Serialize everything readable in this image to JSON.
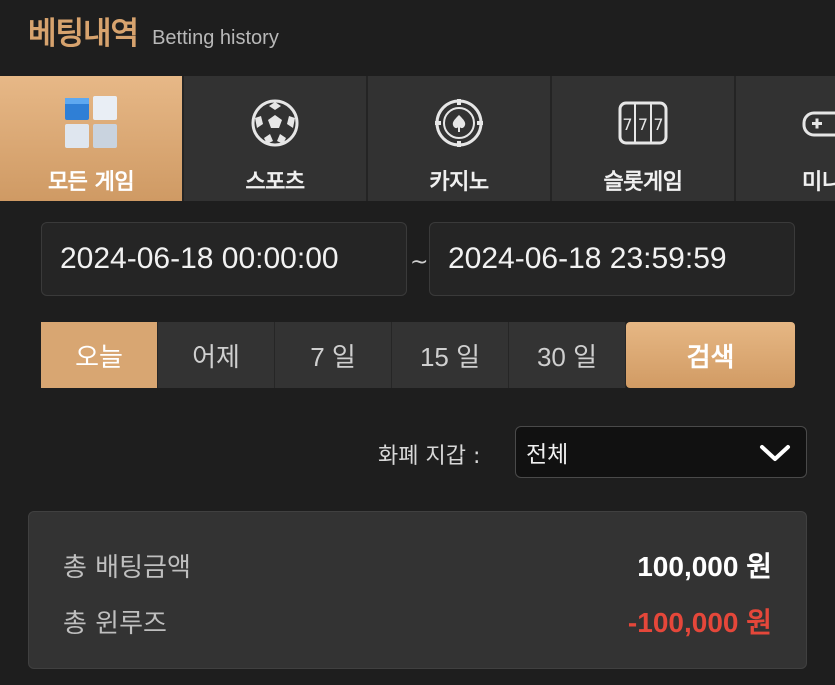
{
  "header": {
    "title": "베팅내역",
    "subtitle": "Betting history"
  },
  "tabs": [
    {
      "label": "모든 게임",
      "icon": "all-games-icon",
      "active": true
    },
    {
      "label": "스포츠",
      "icon": "soccer-ball-icon",
      "active": false
    },
    {
      "label": "카지노",
      "icon": "casino-chip-icon",
      "active": false
    },
    {
      "label": "슬롯게임",
      "icon": "slot-machine-icon",
      "active": false
    },
    {
      "label": "미니",
      "icon": "gamepad-icon",
      "active": false
    }
  ],
  "date_range": {
    "start": "2024-06-18 00:00:00",
    "separator": "~",
    "end": "2024-06-18 23:59:59"
  },
  "periods": [
    {
      "label": "오늘",
      "active": true
    },
    {
      "label": "어제",
      "active": false
    },
    {
      "label": "7 일",
      "active": false
    },
    {
      "label": "15 일",
      "active": false
    },
    {
      "label": "30 일",
      "active": false
    }
  ],
  "search_label": "검색",
  "currency": {
    "label": "화폐 지갑 :",
    "selected": "전체"
  },
  "summary": {
    "total_bet_label": "총 배팅금액",
    "total_bet_value": "100,000 원",
    "total_winloss_label": "총 윈루즈",
    "total_winloss_value": "-100,000 원"
  },
  "colors": {
    "accent": "#d8a672",
    "negative": "#e5473a",
    "background": "#1e1e1e"
  }
}
